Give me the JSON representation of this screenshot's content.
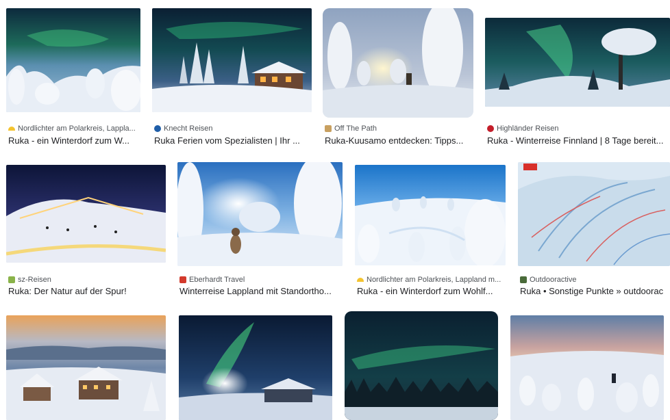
{
  "results": [
    {
      "source": "Nordlichter am Polarkreis, Lappla...",
      "title": "Ruka - ein Winterdorf zum W...",
      "favicon_color": "#f4c430",
      "favicon_icon": "sun-favicon-icon"
    },
    {
      "source": "Knecht Reisen",
      "title": "Ruka Ferien vom Spezialisten | Ihr ...",
      "favicon_color": "#1f5ea8",
      "favicon_icon": "globe-favicon-icon"
    },
    {
      "source": "Off The Path",
      "title": "Ruka-Kuusamo entdecken: Tipps...",
      "favicon_color": "#c8a060",
      "favicon_icon": "compass-favicon-icon"
    },
    {
      "source": "Highländer Reisen",
      "title": "Ruka - Winterreise Finnland | 8 Tage bereit...",
      "favicon_color": "#c41e2a",
      "favicon_icon": "circle-favicon-icon"
    },
    {
      "source": "sz-Reisen",
      "title": "Ruka: Der Natur auf der Spur!",
      "favicon_color": "#8ab34a",
      "favicon_icon": "image-favicon-icon"
    },
    {
      "source": "Eberhardt Travel",
      "title": "Winterreise Lappland mit Standortho...",
      "favicon_color": "#d33a2c",
      "favicon_icon": "e-favicon-icon"
    },
    {
      "source": "Nordlichter am Polarkreis, Lappland m...",
      "title": "Ruka - ein Winterdorf zum Wohlf...",
      "favicon_color": "#f4c430",
      "favicon_icon": "sun-favicon-icon"
    },
    {
      "source": "Outdooractive",
      "title": "Ruka • Sonstige Punkte » outdoorac",
      "favicon_color": "#4a6b3a",
      "favicon_icon": "o-favicon-icon"
    }
  ]
}
